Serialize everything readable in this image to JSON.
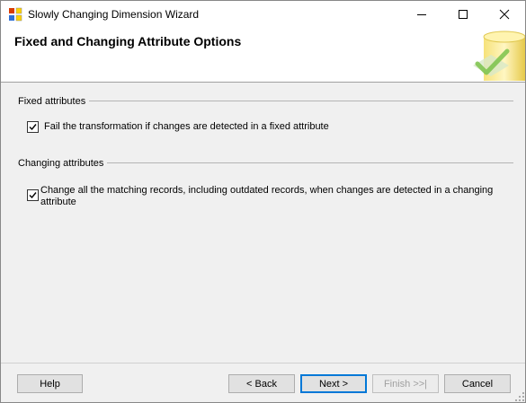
{
  "window": {
    "title": "Slowly Changing Dimension Wizard"
  },
  "header": {
    "title": "Fixed and Changing Attribute Options"
  },
  "fixed_group": {
    "label": "Fixed attributes",
    "checkbox_label": "Fail the transformation if changes are detected in a fixed attribute",
    "checked": true
  },
  "changing_group": {
    "label": "Changing attributes",
    "checkbox_label_line1": "Change all the matching records, including outdated records, when changes are detected in a changing",
    "checkbox_label_line2": "attribute",
    "checked": true
  },
  "buttons": {
    "help": "Help",
    "back": "< Back",
    "next": "Next >",
    "finish": "Finish >>|",
    "cancel": "Cancel"
  },
  "colors": {
    "accent": "#0078d7",
    "disabled_text": "#a0a0a0"
  }
}
